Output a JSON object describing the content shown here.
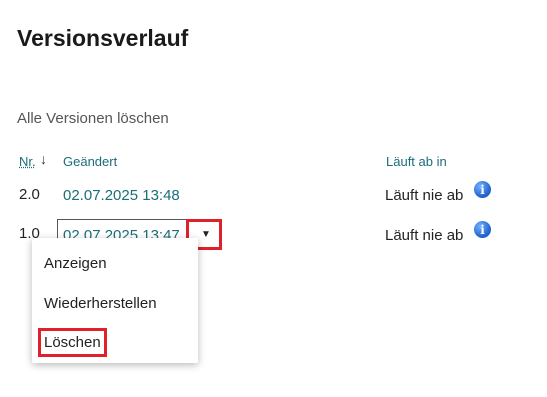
{
  "page": {
    "title": "Versionsverlauf",
    "delete_all": "Alle Versionen löschen"
  },
  "columns": {
    "nr": "Nr.",
    "sort_icon": "↓",
    "changed": "Geändert",
    "expires": "Läuft ab in"
  },
  "rows": [
    {
      "nr": "2.0",
      "date": "02.07.2025 13:48",
      "expires": "Läuft nie ab"
    },
    {
      "nr": "1.0",
      "date": "02.07.2025 13:47",
      "expires": "Läuft nie ab"
    }
  ],
  "icons": {
    "info": "info-icon",
    "info_glyph": "i",
    "caret": "caret-down-icon",
    "caret_glyph": "▼"
  },
  "menu": {
    "items": [
      "Anzeigen",
      "Wiederherstellen",
      "Löschen"
    ]
  },
  "colors": {
    "accent": "#1a6e78",
    "highlight": "#e0202a",
    "info": "#1e5fc9"
  }
}
